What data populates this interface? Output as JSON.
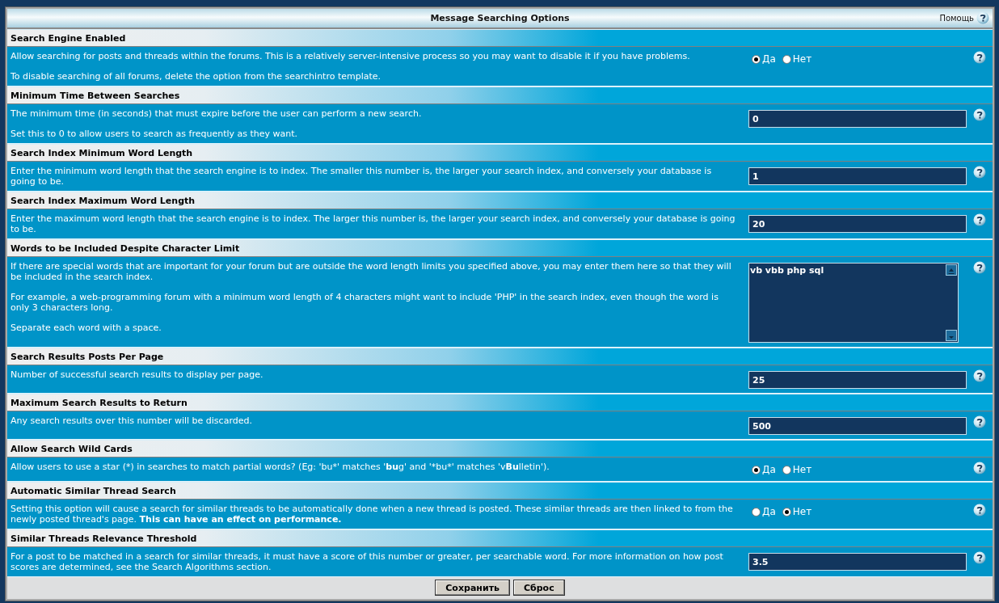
{
  "panel": {
    "title": "Message Searching Options",
    "help_link": "Помощь"
  },
  "settings": [
    {
      "kind": "yesno",
      "title": "Search Engine Enabled",
      "paragraphs": [
        "Allow searching for posts and threads within the forums. This is a relatively server-intensive process so you may want to disable it if you have problems.",
        "To disable searching of all forums, delete the option from the searchintro template."
      ],
      "options": [
        {
          "label": "Да",
          "selected": true
        },
        {
          "label": "Нет",
          "selected": false
        }
      ]
    },
    {
      "kind": "input",
      "title": "Minimum Time Between Searches",
      "paragraphs": [
        "The minimum time (in seconds) that must expire before the user can perform a new search.",
        "Set this to 0 to allow users to search as frequently as they want."
      ],
      "value": "0"
    },
    {
      "kind": "input",
      "title": "Search Index Minimum Word Length",
      "paragraphs": [
        "Enter the minimum word length that the search engine is to index. The smaller this number is, the larger your search index, and conversely your database is going to be."
      ],
      "value": "1"
    },
    {
      "kind": "input",
      "title": "Search Index Maximum Word Length",
      "paragraphs": [
        "Enter the maximum word length that the search engine is to index. The larger this number is, the larger your search index, and conversely your database is going to be."
      ],
      "value": "20"
    },
    {
      "kind": "textarea",
      "title": "Words to be Included Despite Character Limit",
      "paragraphs": [
        "If there are special words that are important for your forum but are outside the word length limits you specified above, you may enter them here so that they will be included in the search index.",
        "For example, a web-programming forum with a minimum word length of 4 characters might want to include 'PHP' in the search index, even though the word is only 3 characters long.",
        "Separate each word with a space."
      ],
      "value": "vb vbb php sql"
    },
    {
      "kind": "input",
      "title": "Search Results Posts Per Page",
      "paragraphs": [
        "Number of successful search results to display per page."
      ],
      "value": "25"
    },
    {
      "kind": "input",
      "title": "Maximum Search Results to Return",
      "paragraphs": [
        "Any search results over this number will be discarded."
      ],
      "value": "500"
    },
    {
      "kind": "yesno",
      "title": "Allow Search Wild Cards",
      "paragraphs": [
        [
          {
            "text": "Allow users to use a star (*) in searches to match partial words? (Eg: 'bu*' matches '",
            "bold": false
          },
          {
            "text": "bu",
            "bold": true
          },
          {
            "text": "g' and '*bu*' matches 'v",
            "bold": false
          },
          {
            "text": "Bu",
            "bold": true
          },
          {
            "text": "lletin').",
            "bold": false
          }
        ]
      ],
      "options": [
        {
          "label": "Да",
          "selected": true
        },
        {
          "label": "Нет",
          "selected": false
        }
      ]
    },
    {
      "kind": "yesno",
      "title": "Automatic Similar Thread Search",
      "paragraphs": [
        "Setting this option will cause a search for similar threads to be automatically done when a new thread is posted. These similar threads are then linked to from the newly posted thread's page. **This can have an effect on performance.**"
      ],
      "options": [
        {
          "label": "Да",
          "selected": false
        },
        {
          "label": "Нет",
          "selected": true
        }
      ]
    },
    {
      "kind": "input",
      "title": "Similar Threads Relevance Threshold",
      "paragraphs": [
        "For a post to be matched in a search for similar threads, it must have a score of this number or greater, per searchable word. For more information on how post scores are determined, see the Search Algorithms section."
      ],
      "value": "3.5"
    }
  ],
  "buttons": [
    "Сохранить",
    "Сброс"
  ]
}
